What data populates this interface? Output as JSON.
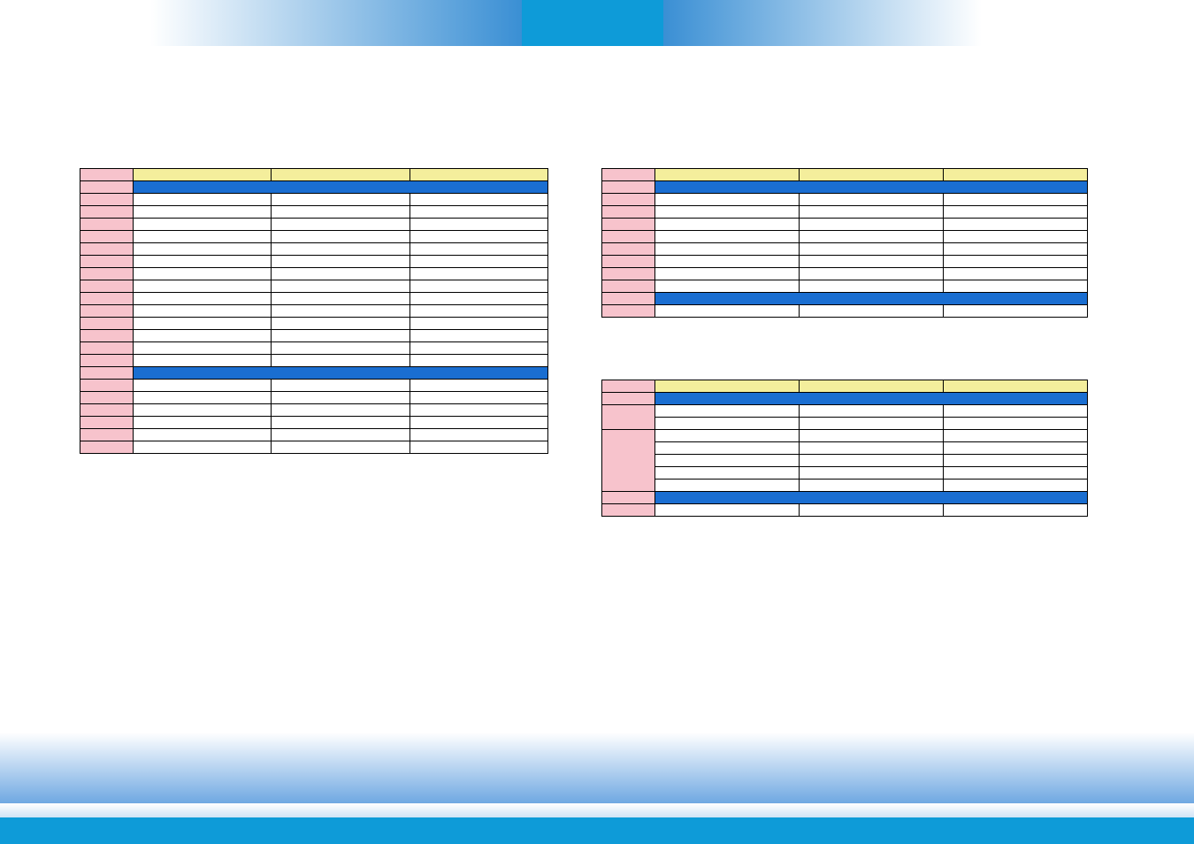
{
  "table1": {
    "corner": "",
    "headers": [
      "",
      "",
      ""
    ],
    "section1_label": "",
    "rows1": [
      [
        "",
        "",
        "",
        ""
      ],
      [
        "",
        "",
        "",
        ""
      ],
      [
        "",
        "",
        "",
        ""
      ],
      [
        "",
        "",
        "",
        ""
      ],
      [
        "",
        "",
        "",
        ""
      ],
      [
        "",
        "",
        "",
        ""
      ],
      [
        "",
        "",
        "",
        ""
      ],
      [
        "",
        "",
        "",
        ""
      ],
      [
        "",
        "",
        "",
        ""
      ],
      [
        "",
        "",
        "",
        ""
      ],
      [
        "",
        "",
        "",
        ""
      ],
      [
        "",
        "",
        "",
        ""
      ],
      [
        "",
        "",
        "",
        ""
      ],
      [
        "",
        "",
        "",
        ""
      ]
    ],
    "section2_label": "",
    "rows2": [
      [
        "",
        "",
        "",
        ""
      ],
      [
        "",
        "",
        "",
        ""
      ],
      [
        "",
        "",
        "",
        ""
      ],
      [
        "",
        "",
        "",
        ""
      ],
      [
        "",
        "",
        "",
        ""
      ],
      [
        "",
        "",
        "",
        ""
      ]
    ]
  },
  "table2": {
    "corner": "",
    "headers": [
      "",
      "",
      ""
    ],
    "section1_label": "",
    "rows1": [
      [
        "",
        "",
        "",
        ""
      ],
      [
        "",
        "",
        "",
        ""
      ],
      [
        "",
        "",
        "",
        ""
      ],
      [
        "",
        "",
        "",
        ""
      ],
      [
        "",
        "",
        "",
        ""
      ],
      [
        "",
        "",
        "",
        ""
      ],
      [
        "",
        "",
        "",
        ""
      ],
      [
        "",
        "",
        "",
        ""
      ]
    ],
    "section2_label": "",
    "rows2": [
      [
        "",
        "",
        "",
        ""
      ]
    ]
  },
  "table3": {
    "corner": "",
    "headers": [
      "",
      "",
      ""
    ],
    "section1_label": "",
    "groups1": [
      {
        "label": "",
        "rows": [
          [
            "",
            "",
            ""
          ],
          [
            "",
            "",
            ""
          ]
        ]
      },
      {
        "label": "",
        "rows": [
          [
            "",
            "",
            ""
          ],
          [
            "",
            "",
            ""
          ],
          [
            "",
            "",
            ""
          ],
          [
            "",
            "",
            ""
          ],
          [
            "",
            "",
            ""
          ]
        ]
      }
    ],
    "section2_label": "",
    "rows2": [
      [
        "",
        "",
        "",
        ""
      ]
    ]
  }
}
